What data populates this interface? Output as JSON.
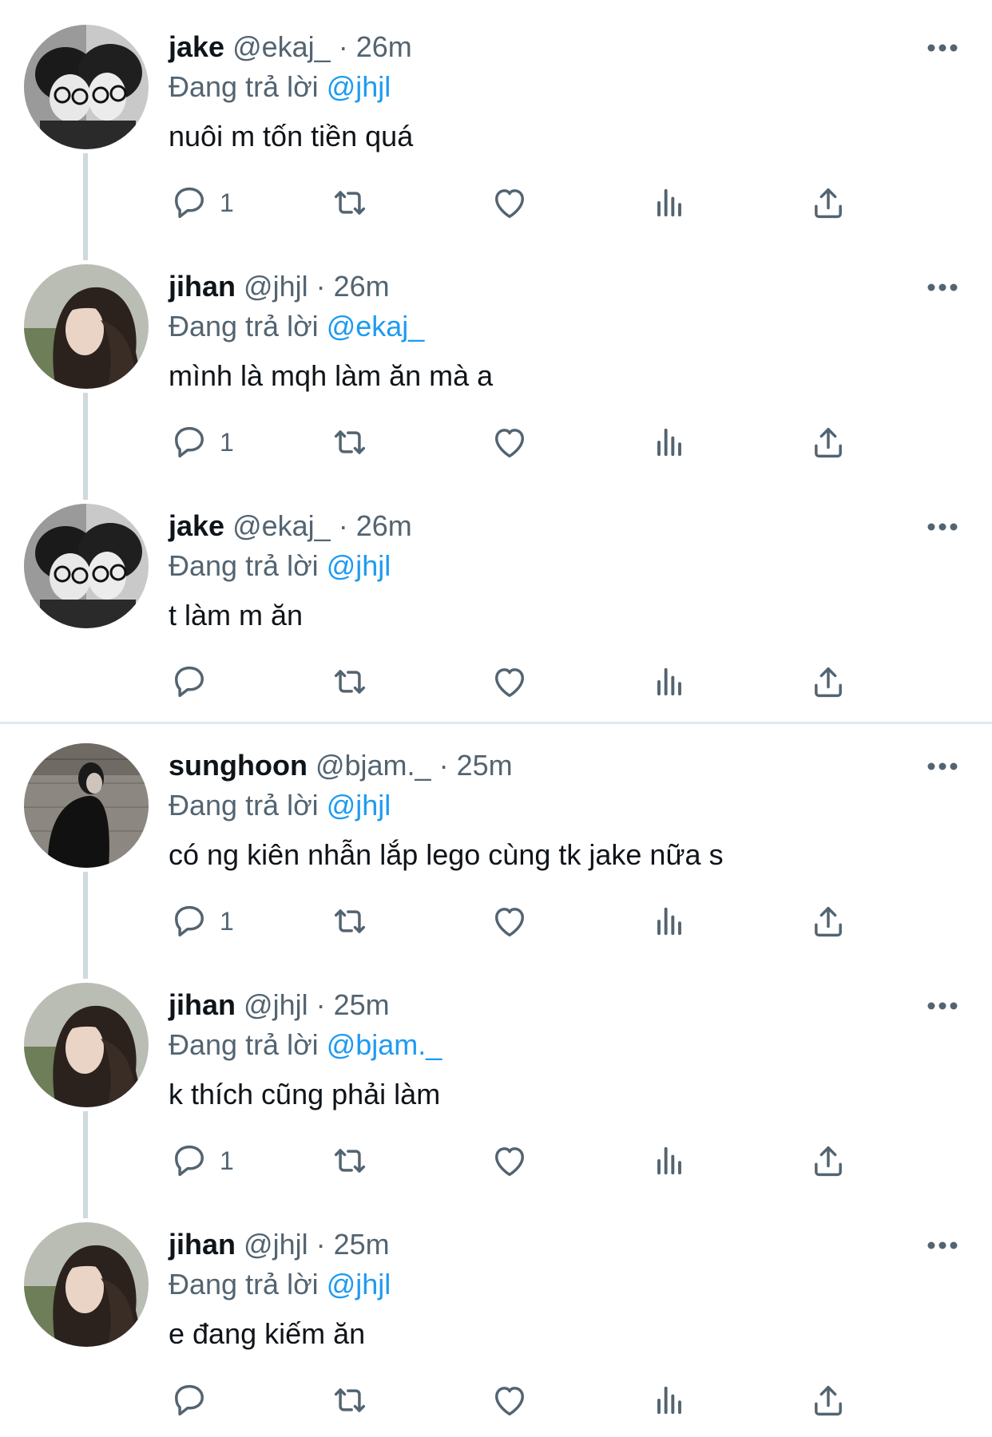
{
  "tweets": [
    {
      "name": "jake",
      "handle": "@ekaj_",
      "sep": "·",
      "time": "26m",
      "reply_prefix": "Đang trả lời",
      "reply_to": "@jhjl",
      "text": "nuôi m tốn tiền quá",
      "reply_count": "1"
    },
    {
      "name": "jihan",
      "handle": "@jhjl",
      "sep": "·",
      "time": "26m",
      "reply_prefix": "Đang trả lời",
      "reply_to": "@ekaj_",
      "text": "mình là mqh làm ăn mà a",
      "reply_count": "1"
    },
    {
      "name": "jake",
      "handle": "@ekaj_",
      "sep": "·",
      "time": "26m",
      "reply_prefix": "Đang trả lời",
      "reply_to": "@jhjl",
      "text": "t làm m ăn",
      "reply_count": ""
    },
    {
      "name": "sunghoon",
      "handle": "@bjam._",
      "sep": "·",
      "time": "25m",
      "reply_prefix": "Đang trả lời",
      "reply_to": "@jhjl",
      "text": "có ng kiên nhẫn lắp lego cùng tk jake nữa s",
      "reply_count": "1"
    },
    {
      "name": "jihan",
      "handle": "@jhjl",
      "sep": "·",
      "time": "25m",
      "reply_prefix": "Đang trả lời",
      "reply_to": "@bjam._",
      "text": "k thích cũng phải làm",
      "reply_count": "1"
    },
    {
      "name": "jihan",
      "handle": "@jhjl",
      "sep": "·",
      "time": "25m",
      "reply_prefix": "Đang trả lời",
      "reply_to": "@jhjl",
      "text": "e đang kiếm ăn",
      "reply_count": ""
    }
  ],
  "icons": {
    "reply": "reply-icon",
    "retweet": "retweet-icon",
    "like": "heart-icon",
    "views": "analytics-icon",
    "share": "share-icon",
    "more": "more-icon"
  },
  "colors": {
    "text": "#0f1419",
    "secondary": "#536471",
    "mention": "#1d9bf0",
    "thread_line": "#cfd9de"
  }
}
